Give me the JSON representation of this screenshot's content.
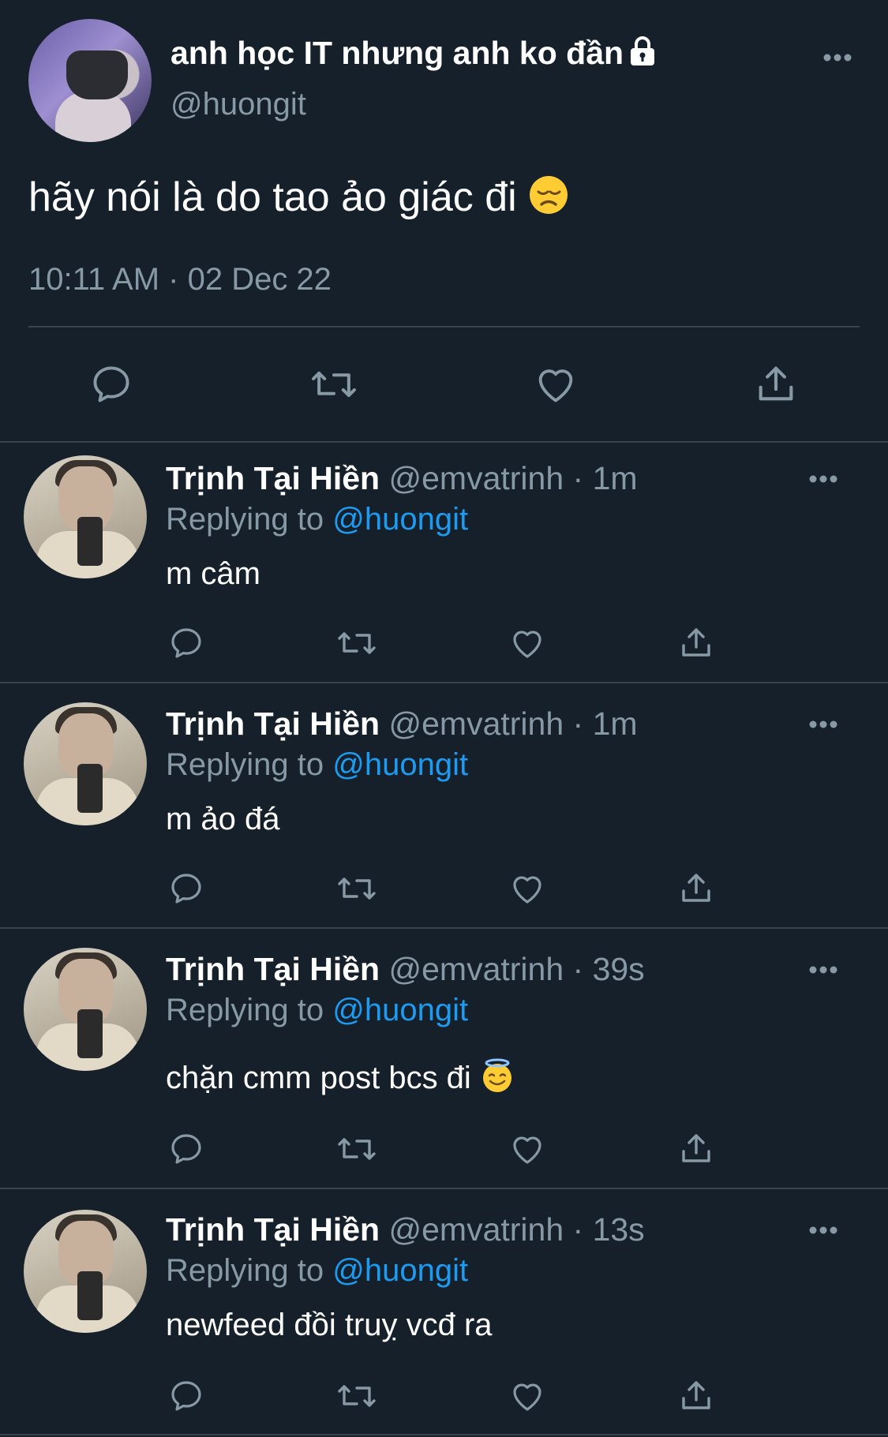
{
  "main_tweet": {
    "author_name": "anh học IT nhưng anh ko đần",
    "author_handle": "@huongit",
    "text": "hãy nói là do tao ảo giác đi",
    "text_emoji": "disappointed-face-emoji",
    "timestamp": "10:11 AM · 02 Dec 22",
    "icons": {
      "lock": "lock-icon",
      "more": "more-icon",
      "reply": "reply-icon",
      "retweet": "retweet-icon",
      "like": "heart-icon",
      "share": "share-icon"
    }
  },
  "replies": [
    {
      "author_name": "Trịnh Tại Hiền",
      "meta": "@emvatrinh · 1m",
      "replying_prefix": "Replying to",
      "replying_handle": "@huongit",
      "text": "m câm",
      "emoji": ""
    },
    {
      "author_name": "Trịnh Tại Hiền",
      "meta": "@emvatrinh · 1m",
      "replying_prefix": "Replying to",
      "replying_handle": "@huongit",
      "text": "m ảo đá",
      "emoji": ""
    },
    {
      "author_name": "Trịnh Tại Hiền",
      "meta": "@emvatrinh · 39s",
      "replying_prefix": "Replying to",
      "replying_handle": "@huongit",
      "text": "chặn cmm post bcs đi",
      "emoji": "smiling-face-with-halo-emoji"
    },
    {
      "author_name": "Trịnh Tại Hiền",
      "meta": "@emvatrinh · 13s",
      "replying_prefix": "Replying to",
      "replying_handle": "@huongit",
      "text": "newfeed đồi truỵ vcđ ra",
      "emoji": ""
    }
  ],
  "colors": {
    "background": "#15202b",
    "divider": "#38444d",
    "secondary_text": "#8899a6",
    "link": "#1d9bf0"
  }
}
